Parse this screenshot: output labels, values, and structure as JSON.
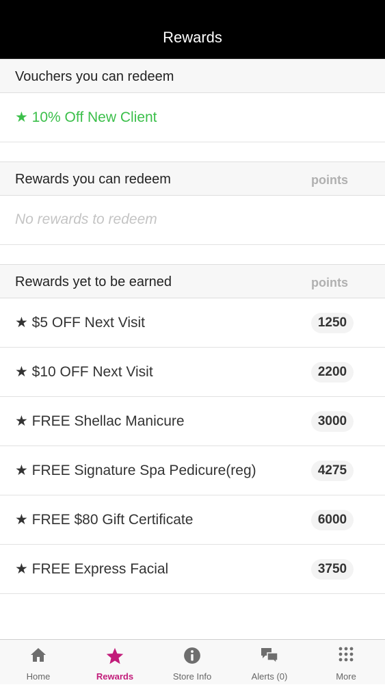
{
  "nav": {
    "title": "Rewards"
  },
  "vouchers": {
    "header": "Vouchers you can redeem",
    "items": [
      {
        "label": "★ 10% Off New Client"
      }
    ]
  },
  "redeemable": {
    "header": "Rewards you can redeem",
    "points_header": "points",
    "empty_text": "No rewards to redeem"
  },
  "to_earn": {
    "header": "Rewards yet to be earned",
    "points_header": "points",
    "items": [
      {
        "label": "★ $5 OFF Next Visit",
        "points": "1250"
      },
      {
        "label": "★ $10 OFF Next Visit",
        "points": "2200"
      },
      {
        "label": "★ FREE Shellac Manicure",
        "points": "3000"
      },
      {
        "label": "★ FREE Signature Spa Pedicure(reg)",
        "points": "4275"
      },
      {
        "label": "★ FREE $80 Gift Certificate",
        "points": "6000"
      },
      {
        "label": "★ FREE Express Facial",
        "points": "3750"
      }
    ]
  },
  "tabbar": {
    "active_color": "#c21c7a",
    "tabs": [
      {
        "label": "Home",
        "icon": "home-icon"
      },
      {
        "label": "Rewards",
        "icon": "star-icon",
        "active": true
      },
      {
        "label": "Store Info",
        "icon": "info-icon"
      },
      {
        "label": "Alerts (0)",
        "icon": "chat-icon"
      },
      {
        "label": "More",
        "icon": "grid-icon"
      }
    ]
  }
}
